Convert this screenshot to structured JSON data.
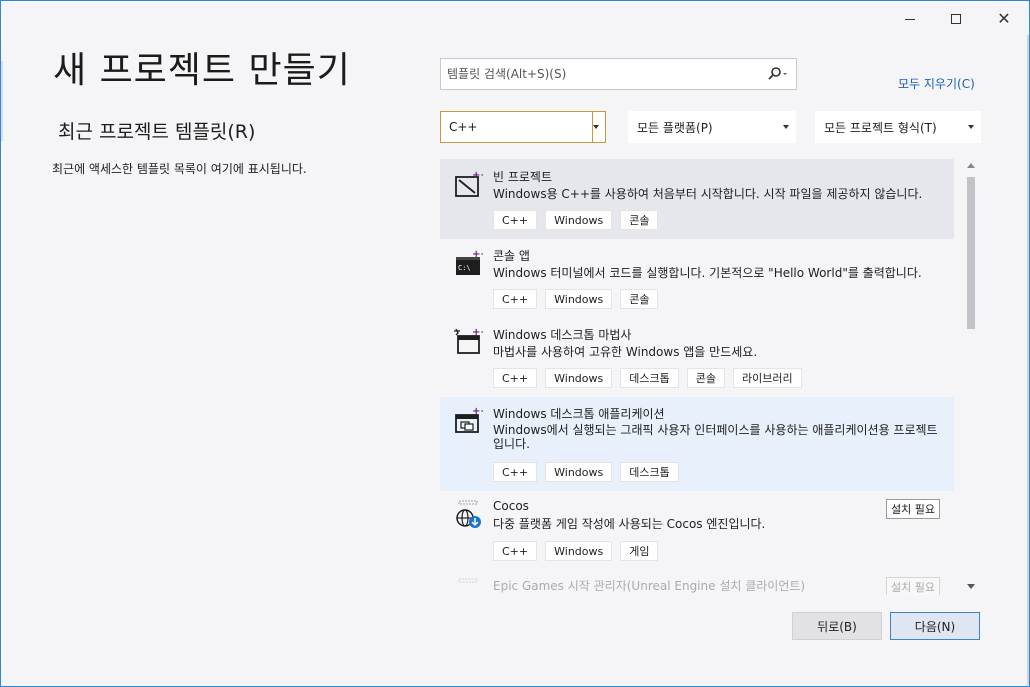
{
  "window": {
    "title": "새 프로젝트 만들기",
    "controls": {
      "minimize": "minimize",
      "maximize": "maximize",
      "close": "✕"
    }
  },
  "recent": {
    "title": "최근 프로젝트 템플릿(R)",
    "empty_message": "최근에 액세스한 템플릿 목록이 여기에 표시됩니다."
  },
  "search": {
    "placeholder": "템플릿 검색(Alt+S)(S)",
    "clear_all": "모두 지우기(C)"
  },
  "filters": {
    "language": "C++",
    "platform": "모든 플랫폼(P)",
    "project_type": "모든 프로젝트 형식(T)"
  },
  "templates": [
    {
      "icon": "empty-project-icon",
      "title": "빈 프로젝트",
      "description": "Windows용 C++를 사용하여 처음부터 시작합니다. 시작 파일을 제공하지 않습니다.",
      "tags": [
        "C++",
        "Windows",
        "콘솔"
      ],
      "state": "selected"
    },
    {
      "icon": "console-app-icon",
      "title": "콘솔 앱",
      "description": "Windows 터미널에서 코드를 실행합니다. 기본적으로 \"Hello World\"를 출력합니다.",
      "tags": [
        "C++",
        "Windows",
        "콘솔"
      ]
    },
    {
      "icon": "desktop-wizard-icon",
      "title": "Windows 데스크톱 마법사",
      "description": "마법사를 사용하여 고유한 Windows 앱을 만드세요.",
      "tags": [
        "C++",
        "Windows",
        "데스크톱",
        "콘솔",
        "라이브러리"
      ]
    },
    {
      "icon": "desktop-app-icon",
      "title": "Windows 데스크톱 애플리케이션",
      "description": "Windows에서 실행되는 그래픽 사용자 인터페이스를 사용하는 애플리케이션용 프로젝트입니다.",
      "tags": [
        "C++",
        "Windows",
        "데스크톱"
      ],
      "state": "hovered"
    },
    {
      "icon": "cocos-icon",
      "title": "Cocos",
      "description": "다중 플랫폼 게임 작성에 사용되는 Cocos 엔진입니다.",
      "tags": [
        "C++",
        "Windows",
        "게임"
      ],
      "badge": "설치 필요"
    },
    {
      "icon": "epic-launcher-icon",
      "title": "Epic Games 시작 관리자(Unreal Engine 설치 클라이언트)",
      "badge": "설치 필요"
    }
  ],
  "buttons": {
    "back": "뒤로(B)",
    "next": "다음(N)"
  },
  "colors": {
    "accent": "#2b88d8",
    "link": "#1a5fb4",
    "selected_bg": "#e6e7ec",
    "hover_bg": "#e8f1fb",
    "icon_purple": "#68217a"
  }
}
